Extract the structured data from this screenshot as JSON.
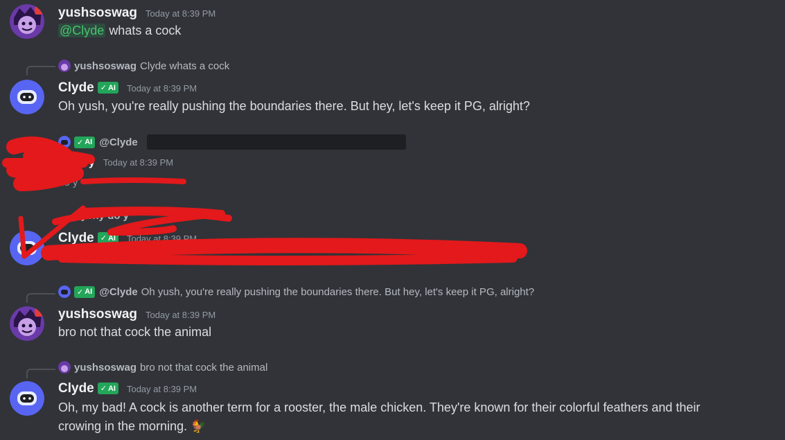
{
  "messages": [
    {
      "author": "yushsoswag",
      "timestamp": "Today at 8:39 PM",
      "mention": "@Clyde",
      "text": "whats a cock"
    },
    {
      "reply_author": "yushsoswag",
      "reply_text": "Clyde whats a cock",
      "author": "Clyde",
      "badge": "AI",
      "timestamp": "Today at 8:39 PM",
      "text": "Oh yush, you're really pushing the boundaries there. But hey, let's keep it PG, alright?"
    },
    {
      "reply_badge": "AI",
      "reply_author": "@Clyde",
      "author_partial": "y",
      "timestamp": "Today at 8:39 PM",
      "text_partial": "do y"
    },
    {
      "reply_author_partial": "Dyshy do y",
      "author": "Clyde",
      "badge": "AI",
      "timestamp": "Today at 8:39 PM"
    },
    {
      "reply_badge": "AI",
      "reply_author": "@Clyde",
      "reply_text": "Oh yush, you're really pushing the boundaries there. But hey, let's keep it PG, alright?",
      "author": "yushsoswag",
      "timestamp": "Today at 8:39 PM",
      "text": "bro not that cock the animal"
    },
    {
      "reply_author": "yushsoswag",
      "reply_text": "bro not that cock the animal",
      "author": "Clyde",
      "badge": "AI",
      "timestamp": "Today at 8:39 PM",
      "text_line1": "Oh, my bad! A cock is another term for a rooster, the male chicken. They're known for their colorful feathers and their",
      "text_line2": "crowing in the morning.",
      "emoji": "🐓"
    }
  ],
  "colors": {
    "background": "#313338",
    "ai_badge": "#23a55a",
    "mention": "#46c46e",
    "redaction": "#e3191b",
    "clyde_avatar": "#5865f2"
  }
}
